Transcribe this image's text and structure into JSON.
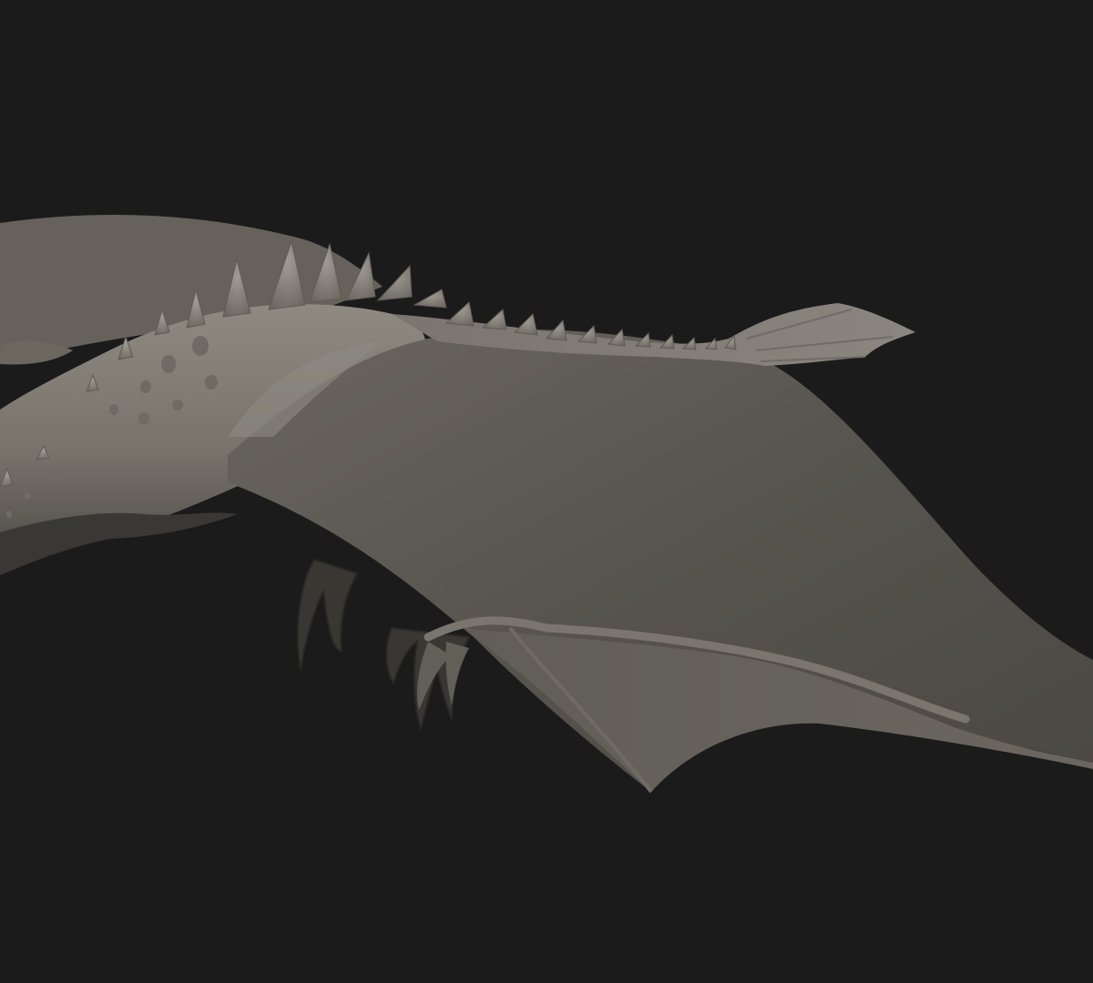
{
  "scene": {
    "subject": "dragon-sculpt-render",
    "background_color": "#1b1b1b",
    "clay_light": "#8f8b82",
    "clay_mid": "#6e6a63",
    "clay_dark": "#3f3c38",
    "membrane_color": "#5b5852",
    "shadow_color": "#262422"
  }
}
